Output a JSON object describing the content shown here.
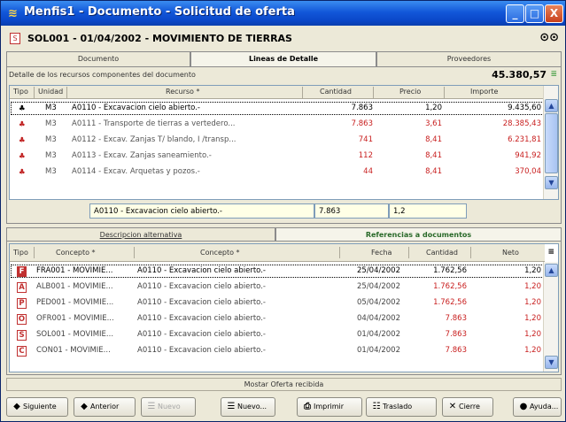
{
  "window": {
    "title": "Menfis1 - Documento - Solicitud de oferta",
    "min_label": "_",
    "max_label": "□",
    "close_label": "X"
  },
  "document": {
    "title": "SOL001 - 01/04/2002 - MOVIMIENTO DE TIERRAS",
    "doc_icon_label": "S"
  },
  "tabs": [
    {
      "label": "Documento",
      "active": false
    },
    {
      "label": "Lineas de Detalle",
      "active": true
    },
    {
      "label": "Proveedores",
      "active": false
    }
  ],
  "detail": {
    "caption": "Detalle de los recursos componentes del documento",
    "total": "45.380,57",
    "columns": [
      "Tipo",
      "Unidad",
      "Recurso *",
      "Cantidad",
      "Precio",
      "Importe"
    ],
    "rows": [
      {
        "unidad": "M3",
        "recurso": "A0110 - Excavacion cielo abierto.-",
        "cantidad": "7.863",
        "precio": "1,20",
        "importe": "9.435,60",
        "selected": true
      },
      {
        "unidad": "M3",
        "recurso": "A0111 - Transporte de tierras a vertedero...",
        "cantidad": "7.863",
        "precio": "3,61",
        "importe": "28.385,43",
        "selected": false
      },
      {
        "unidad": "M3",
        "recurso": "A0112 - Excav. Zanjas T/ blando, I /transp...",
        "cantidad": "741",
        "precio": "8,41",
        "importe": "6.231,81",
        "selected": false
      },
      {
        "unidad": "M3",
        "recurso": "A0113 - Excav. Zanjas saneamiento.-",
        "cantidad": "112",
        "precio": "8,41",
        "importe": "941,92",
        "selected": false
      },
      {
        "unidad": "M3",
        "recurso": "A0114 - Excav. Arquetas y pozos.-",
        "cantidad": "44",
        "precio": "8,41",
        "importe": "370,04",
        "selected": false
      }
    ],
    "edit_recurso": "A0110 - Excavacion cielo abierto.-",
    "edit_cantidad": "7.863",
    "edit_precio": "1,2"
  },
  "tabs2": [
    {
      "label": "Descripcion alternativa",
      "active": false
    },
    {
      "label": "Referencias a documentos",
      "active": true
    }
  ],
  "references": {
    "columns": [
      "Tipo",
      "Concepto *",
      "Concepto *",
      "Fecha",
      "Cantidad",
      "Neto"
    ],
    "rows": [
      {
        "type_icon": "F",
        "doc": "FRA001 - MOVIMIE...",
        "concepto": "A0110 - Excavacion cielo abierto.-",
        "fecha": "25/04/2002",
        "cantidad": "1.762,56",
        "neto": "1,20",
        "selected": true
      },
      {
        "type_icon": "A",
        "doc": "ALB001 - MOVIMIE...",
        "concepto": "A0110 - Excavacion cielo abierto.-",
        "fecha": "25/04/2002",
        "cantidad": "1.762,56",
        "neto": "1,20",
        "selected": false
      },
      {
        "type_icon": "P",
        "doc": "PED001 - MOVIMIE...",
        "concepto": "A0110 - Excavacion cielo abierto.-",
        "fecha": "05/04/2002",
        "cantidad": "1.762,56",
        "neto": "1,20",
        "selected": false
      },
      {
        "type_icon": "O",
        "doc": "OFR001 - MOVIMIE...",
        "concepto": "A0110 - Excavacion cielo abierto.-",
        "fecha": "04/04/2002",
        "cantidad": "7.863",
        "neto": "1,20",
        "selected": false
      },
      {
        "type_icon": "S",
        "doc": "SOL001 - MOVIMIE...",
        "concepto": "A0110 - Excavacion cielo abierto.-",
        "fecha": "01/04/2002",
        "cantidad": "7.863",
        "neto": "1,20",
        "selected": false
      },
      {
        "type_icon": "C",
        "doc": "CON01 - MOVIMIE...",
        "concepto": "A0110 - Excavacion cielo abierto.-",
        "fecha": "01/04/2002",
        "cantidad": "7.863",
        "neto": "1,20",
        "selected": false
      }
    ]
  },
  "show_offer_label": "Mostar Oferta recibida",
  "toolbar": {
    "siguiente": "Siguiente",
    "anterior": "Anterior",
    "nuevo_disabled": "Nuevo",
    "nuevo": "Nuevo...",
    "imprimir": "Imprimir",
    "traslado": "Traslado",
    "cierre": "Cierre",
    "ayuda": "Ayuda..."
  },
  "colors": {
    "titlebar": "#0a47c8",
    "selection": "#0a246a",
    "importe_red": "#c81e1e",
    "header_bg": "#ece9d8"
  }
}
